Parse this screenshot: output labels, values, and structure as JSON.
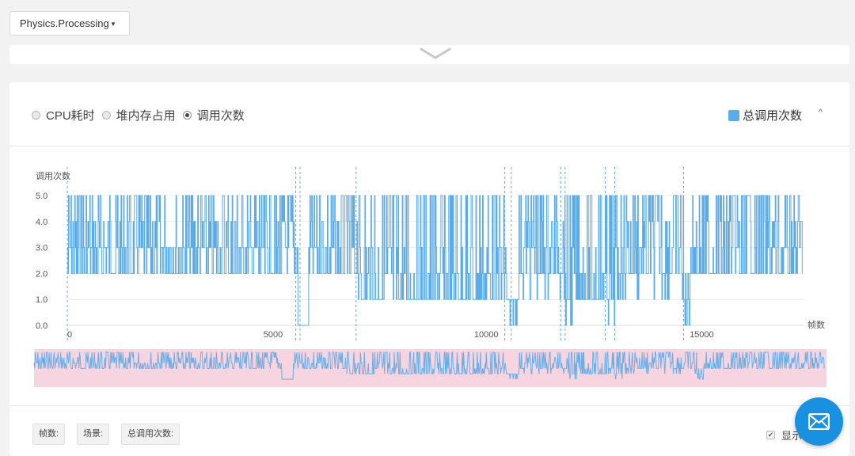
{
  "selector": {
    "label": "Physics.Processing",
    "caret": "▾"
  },
  "collapse": {
    "icon": "chevron-down-icon"
  },
  "panel": {
    "modes": [
      {
        "label": "CPU耗时",
        "selected": false
      },
      {
        "label": "堆内存占用",
        "selected": false
      },
      {
        "label": "调用次数",
        "selected": true
      }
    ],
    "legend_label": "总调用次数",
    "legend_color": "#5aabe6",
    "collapse_up_glyph": "^"
  },
  "chart_data": {
    "type": "line",
    "ylabel": "调用次数",
    "xlabel": "帧数",
    "ylim": [
      0,
      5
    ],
    "yticks": [
      "0.0",
      "1.0",
      "2.0",
      "3.0",
      "4.0",
      "5.0"
    ],
    "xlim": [
      0,
      17100
    ],
    "xticks": [
      {
        "value": 0,
        "label": "0"
      },
      {
        "value": 5000,
        "label": "5000"
      },
      {
        "value": 10000,
        "label": "10000"
      },
      {
        "value": 15000,
        "label": "15000"
      }
    ],
    "series": [
      {
        "color": "#5aabe6",
        "segments": [
          {
            "x": [
              0,
              100
            ],
            "base": 2,
            "low": 2,
            "high": 5
          },
          {
            "x": [
              100,
              5350
            ],
            "base": 2,
            "low": 2,
            "high": 5
          },
          {
            "x": [
              5350,
              5600
            ],
            "base": 0,
            "low": 0,
            "high": 0
          },
          {
            "x": [
              5600,
              6750
            ],
            "base": 2,
            "low": 2,
            "high": 5
          },
          {
            "x": [
              6750,
              10200
            ],
            "base": 1,
            "low": 1,
            "high": 5
          },
          {
            "x": [
              10200,
              10450
            ],
            "base": 0,
            "low": 0,
            "high": 1
          },
          {
            "x": [
              10450,
              11550
            ],
            "base": 2,
            "low": 1,
            "high": 5
          },
          {
            "x": [
              11550,
              11850
            ],
            "base": 1,
            "low": 0,
            "high": 5
          },
          {
            "x": [
              11850,
              12550
            ],
            "base": 1,
            "low": 1,
            "high": 5
          },
          {
            "x": [
              12550,
              12800
            ],
            "base": 1,
            "low": 0,
            "high": 5
          },
          {
            "x": [
              12800,
              14300
            ],
            "base": 2,
            "low": 1,
            "high": 5
          },
          {
            "x": [
              14300,
              14450
            ],
            "base": 0,
            "low": 0,
            "high": 2
          },
          {
            "x": [
              14450,
              17050
            ],
            "base": 2,
            "low": 2,
            "high": 5
          }
        ]
      }
    ],
    "markers": [
      0,
      5300,
      5400,
      6700,
      10150,
      10300,
      11450,
      11550,
      12480,
      12700,
      14300
    ]
  },
  "footer": {
    "frame_label": "帧数:",
    "scene_label": "场景:",
    "total_label": "总调用次数:",
    "show_label": "显示",
    "show_checked": "✔"
  },
  "fab": {
    "icon": "mail-icon"
  }
}
